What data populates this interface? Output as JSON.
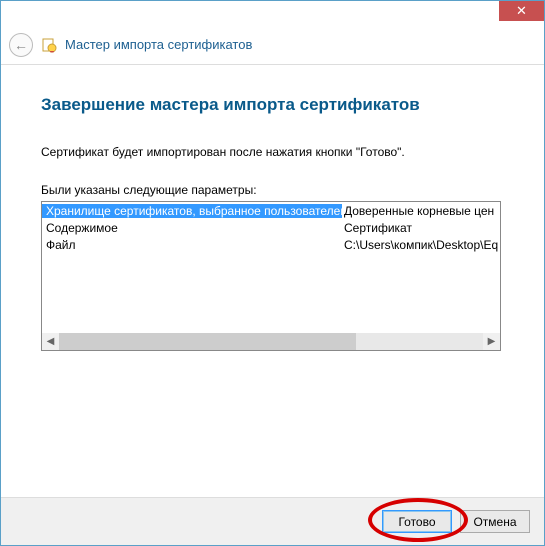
{
  "window": {
    "title": "Мастер импорта сертификатов"
  },
  "page": {
    "heading": "Завершение мастера импорта сертификатов",
    "description": "Сертификат будет импортирован после нажатия кнопки \"Готово\".",
    "params_label": "Были указаны следующие параметры:"
  },
  "params": {
    "rows": [
      {
        "name": "Хранилище сертификатов, выбранное пользователем",
        "value": "Доверенные корневые цен"
      },
      {
        "name": "Содержимое",
        "value": "Сертификат"
      },
      {
        "name": "Файл",
        "value": "C:\\Users\\компик\\Desktop\\Eq"
      }
    ]
  },
  "footer": {
    "finish": "Готово",
    "cancel": "Отмена"
  },
  "icons": {
    "close": "✕",
    "back": "←",
    "scroll_left": "◀",
    "scroll_right": "▶"
  }
}
